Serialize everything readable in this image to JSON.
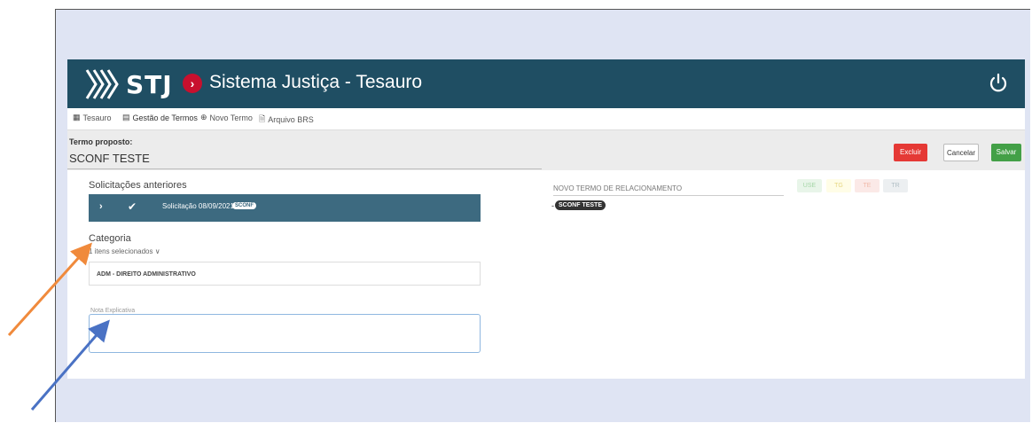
{
  "header": {
    "logo_text": "STJ",
    "separator_glyph": "›",
    "title": "Sistema Justiça - Tesauro"
  },
  "tabs": [
    {
      "label": "Tesauro",
      "icon": "grid-icon"
    },
    {
      "label": "Gestão de Termos",
      "icon": "table-icon"
    },
    {
      "label": "Novo Termo",
      "icon": "plus-circle-icon"
    },
    {
      "label": "Arquivo BRS",
      "icon": "file-icon"
    }
  ],
  "term": {
    "label": "Termo proposto:",
    "value": "SCONF TESTE"
  },
  "actions": {
    "excluir": "Excluir",
    "cancelar": "Cancelar",
    "salvar": "Salvar"
  },
  "solicitacoes": {
    "title": "Solicitações anteriores",
    "item_text": "Solicitação 08/09/2021",
    "item_badge": "SCONF"
  },
  "categoria": {
    "title": "Categoria",
    "select_text": "1 itens selecionados ∨",
    "value": "ADM - DIREITO ADMINISTRATIVO"
  },
  "nota": {
    "label": "Nota Explicativa"
  },
  "relacionamento": {
    "label": "NOVO TERMO DE RELACIONAMENTO",
    "tag": "SCONF TESTE",
    "buttons": [
      "USE",
      "TG",
      "TE",
      "TR"
    ]
  },
  "colors": {
    "topbar": "#1f4e63",
    "solicitacao_bar": "#3d6a80",
    "excluir": "#e53935",
    "salvar": "#43a047",
    "arrow_orange": "#f08a3c",
    "arrow_blue": "#4a72c4"
  }
}
